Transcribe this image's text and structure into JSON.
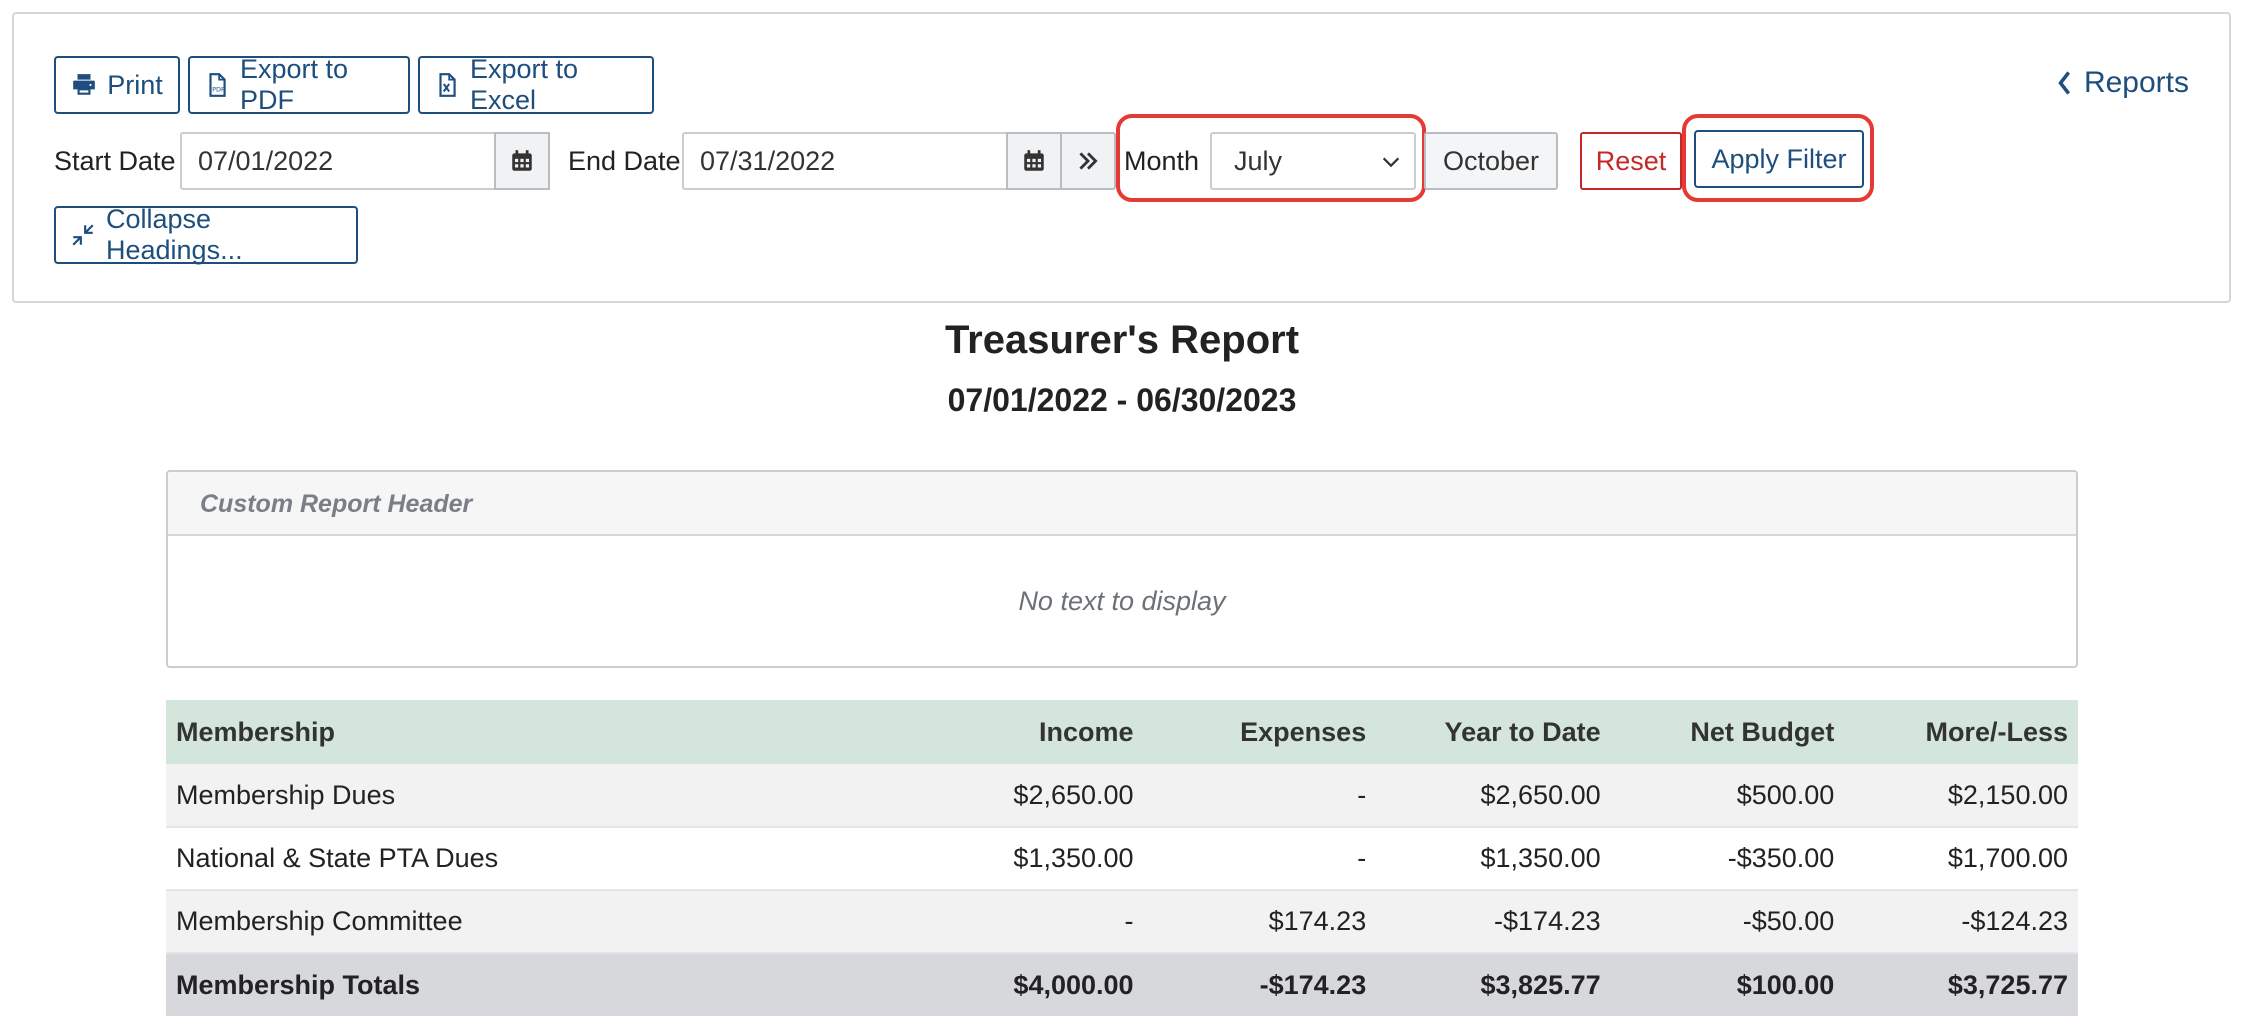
{
  "toolbar": {
    "print_label": "Print",
    "export_pdf_label": "Export to PDF",
    "export_excel_label": "Export to Excel",
    "collapse_label": "Collapse Headings..."
  },
  "filters": {
    "start_date_label": "Start Date",
    "start_date_value": "07/01/2022",
    "end_date_label": "End Date",
    "end_date_value": "07/31/2022",
    "month_label": "Month",
    "month_selected": "July",
    "october_label": "October",
    "reset_label": "Reset",
    "apply_label": "Apply Filter"
  },
  "nav": {
    "reports_label": "Reports"
  },
  "report": {
    "title": "Treasurer's Report",
    "range": "07/01/2022 - 06/30/2023"
  },
  "custom_header": {
    "title": "Custom Report Header",
    "body": "No text to display"
  },
  "table": {
    "columns": [
      "Membership",
      "Income",
      "Expenses",
      "Year to Date",
      "Net Budget",
      "More/-Less"
    ],
    "rows": [
      [
        "Membership Dues",
        "$2,650.00",
        "-",
        "$2,650.00",
        "$500.00",
        "$2,150.00"
      ],
      [
        "National & State PTA Dues",
        "$1,350.00",
        "-",
        "$1,350.00",
        "-$350.00",
        "$1,700.00"
      ],
      [
        "Membership Committee",
        "-",
        "$174.23",
        "-$174.23",
        "-$50.00",
        "-$124.23"
      ]
    ],
    "totals": [
      "Membership Totals",
      "$4,000.00",
      "-$174.23",
      "$3,825.77",
      "$100.00",
      "$3,725.77"
    ]
  },
  "colors": {
    "accent": "#1d4e7e",
    "danger": "#c62828",
    "highlight": "#e53935",
    "table_header_bg": "#d4e6dc"
  }
}
